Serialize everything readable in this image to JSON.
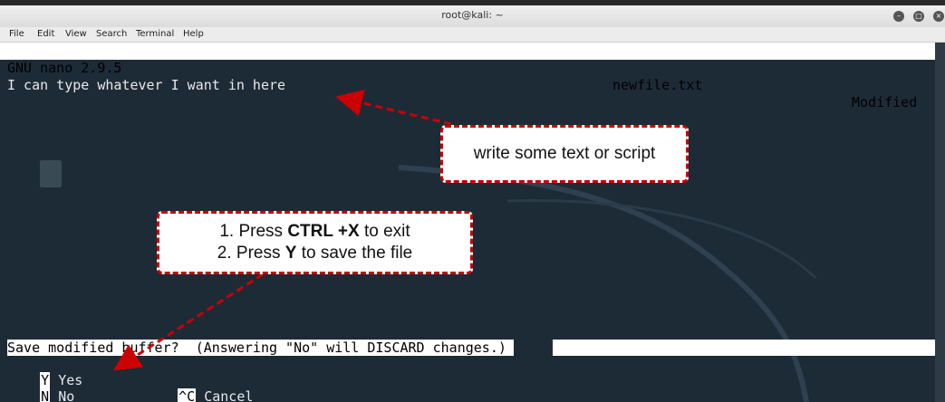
{
  "window": {
    "title": "root@kali: ~",
    "buttons": [
      "minimize",
      "maximize",
      "close"
    ]
  },
  "menubar": {
    "items": [
      "File",
      "Edit",
      "View",
      "Search",
      "Terminal",
      "Help"
    ]
  },
  "nano": {
    "version": "GNU nano 2.9.5",
    "filename": "newfile.txt",
    "status": "Modified",
    "buffer_text": "I can type whatever I want in here",
    "prompt": "Save modified buffer?  (Answering \"No\" will DISCARD changes.)",
    "options": [
      {
        "key": "Y",
        "label": "Yes"
      },
      {
        "key": "N",
        "label": "No"
      },
      {
        "key": "^C",
        "label": "Cancel"
      }
    ]
  },
  "annotations": {
    "callout1": "write some text or script",
    "callout2_line1_pre": "1. Press  ",
    "callout2_line1_bold": "CTRL +X",
    "callout2_line1_post": " to exit",
    "callout2_line2_pre": "2. Press ",
    "callout2_line2_bold": "Y",
    "callout2_line2_post": " to save the file",
    "accent_color": "#cc0000"
  }
}
